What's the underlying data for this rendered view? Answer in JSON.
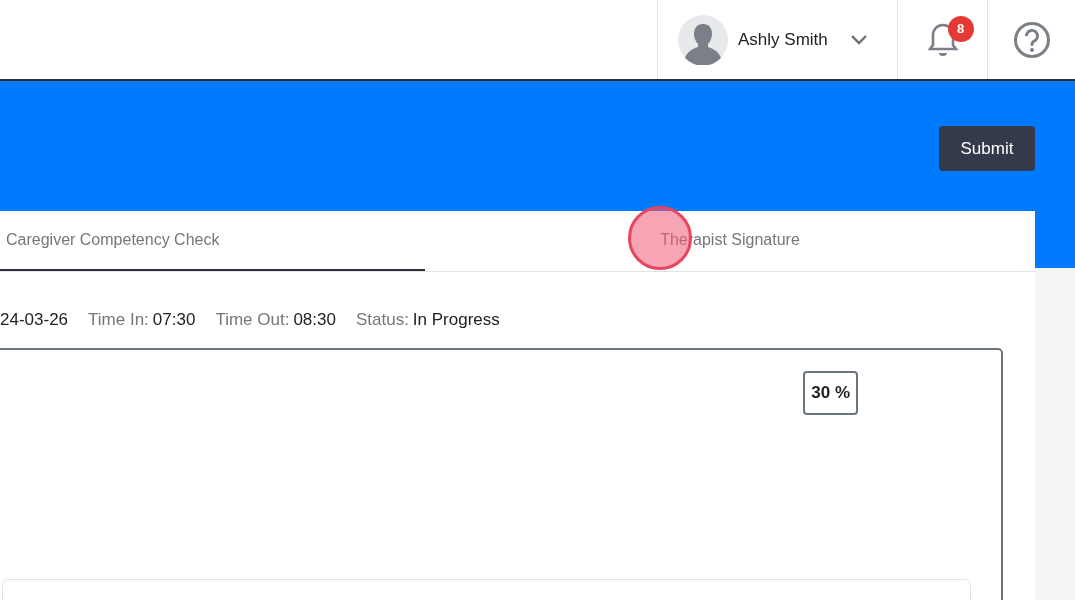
{
  "user_menu": {
    "name": "Ashly Smith"
  },
  "notifications": {
    "count": "8"
  },
  "header": {
    "submit_label": "Submit"
  },
  "tabs": [
    {
      "label": "Caregiver Competency Check",
      "selected": true
    },
    {
      "label": "Therapist Signature",
      "selected": false
    }
  ],
  "visit_info": [
    {
      "value": "24-03-26"
    },
    {
      "label": "Time In:",
      "value": "07:30"
    },
    {
      "label": "Time Out:",
      "value": "08:30"
    },
    {
      "label": "Status:",
      "value": "In Progress"
    }
  ],
  "progress": {
    "text": "30 %"
  }
}
